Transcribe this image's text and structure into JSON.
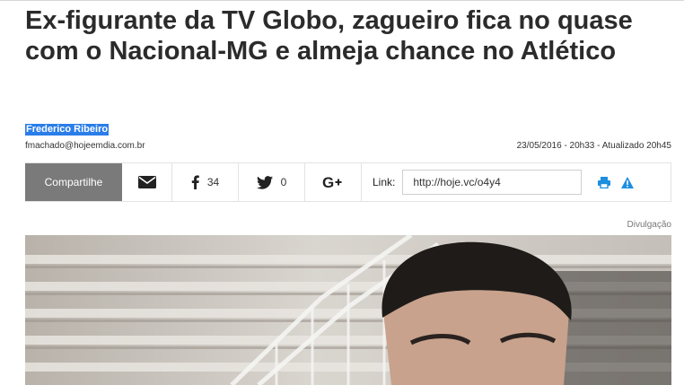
{
  "article": {
    "headline": "Ex-figurante da TV Globo, zagueiro fica no quase com o Nacional-MG e almeja chance no Atlético",
    "author_name": "Frederico Ribeiro",
    "author_email": "fmachado@hojeemdia.com.br",
    "date_line": "23/05/2016 - 20h33 - Atualizado 20h45",
    "photo_credit": "Divulgação"
  },
  "share": {
    "button_label": "Compartilhe",
    "facebook_count": "34",
    "twitter_count": "0",
    "link_label": "Link:",
    "link_value": "http://hoje.vc/o4y4",
    "icons": [
      "mail-icon",
      "facebook-icon",
      "twitter-icon",
      "google-plus-icon",
      "print-icon",
      "alert-icon"
    ]
  },
  "colors": {
    "author_highlight": "#2b7de9",
    "share_button": "#7a7a7a",
    "tool_icon": "#1d8fe0"
  }
}
